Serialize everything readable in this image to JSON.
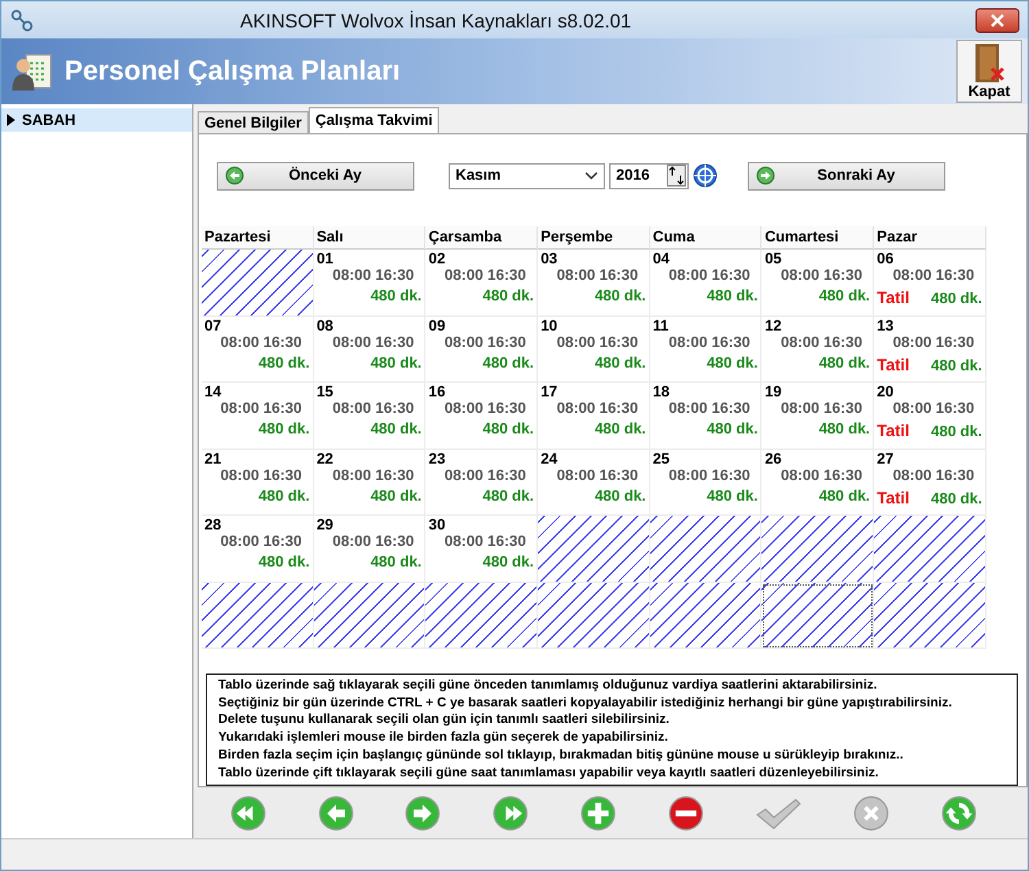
{
  "window": {
    "title": "AKINSOFT Wolvox İnsan Kaynakları s8.02.01"
  },
  "header": {
    "title": "Personel Çalışma Planları",
    "close_label": "Kapat"
  },
  "sidebar": {
    "items": [
      {
        "label": "SABAH",
        "selected": true
      }
    ]
  },
  "tabs": [
    {
      "label": "Genel Bilgiler",
      "selected": false
    },
    {
      "label": "Çalışma Takvimi",
      "selected": true
    }
  ],
  "navigation": {
    "previous": "Önceki Ay",
    "month": "Kasım",
    "year": "2016",
    "next": "Sonraki Ay"
  },
  "calendar": {
    "weekdays": [
      "Pazartesi",
      "Salı",
      "Çarsamba",
      "Perşembe",
      "Cuma",
      "Cumartesi",
      "Pazar"
    ],
    "weeks": [
      [
        {
          "kind": "blank",
          "selected": false
        },
        {
          "kind": "day",
          "day": "01",
          "hours": "08:00 16:30",
          "minutes": "480 dk.",
          "selected": false
        },
        {
          "kind": "day",
          "day": "02",
          "hours": "08:00 16:30",
          "minutes": "480 dk.",
          "selected": false
        },
        {
          "kind": "day",
          "day": "03",
          "hours": "08:00 16:30",
          "minutes": "480 dk.",
          "selected": false
        },
        {
          "kind": "day",
          "day": "04",
          "hours": "08:00 16:30",
          "minutes": "480 dk.",
          "selected": false
        },
        {
          "kind": "day",
          "day": "05",
          "hours": "08:00 16:30",
          "minutes": "480 dk.",
          "selected": false
        },
        {
          "kind": "day",
          "day": "06",
          "hours": "08:00 16:30",
          "minutes": "480 dk.",
          "holiday": "Tatil",
          "selected": false
        }
      ],
      [
        {
          "kind": "day",
          "day": "07",
          "hours": "08:00 16:30",
          "minutes": "480 dk.",
          "selected": false
        },
        {
          "kind": "day",
          "day": "08",
          "hours": "08:00 16:30",
          "minutes": "480 dk.",
          "selected": false
        },
        {
          "kind": "day",
          "day": "09",
          "hours": "08:00 16:30",
          "minutes": "480 dk.",
          "selected": false
        },
        {
          "kind": "day",
          "day": "10",
          "hours": "08:00 16:30",
          "minutes": "480 dk.",
          "selected": false
        },
        {
          "kind": "day",
          "day": "11",
          "hours": "08:00 16:30",
          "minutes": "480 dk.",
          "selected": false
        },
        {
          "kind": "day",
          "day": "12",
          "hours": "08:00 16:30",
          "minutes": "480 dk.",
          "selected": false
        },
        {
          "kind": "day",
          "day": "13",
          "hours": "08:00 16:30",
          "minutes": "480 dk.",
          "holiday": "Tatil",
          "selected": false
        }
      ],
      [
        {
          "kind": "day",
          "day": "14",
          "hours": "08:00 16:30",
          "minutes": "480 dk.",
          "selected": false
        },
        {
          "kind": "day",
          "day": "15",
          "hours": "08:00 16:30",
          "minutes": "480 dk.",
          "selected": false
        },
        {
          "kind": "day",
          "day": "16",
          "hours": "08:00 16:30",
          "minutes": "480 dk.",
          "selected": false
        },
        {
          "kind": "day",
          "day": "17",
          "hours": "08:00 16:30",
          "minutes": "480 dk.",
          "selected": false
        },
        {
          "kind": "day",
          "day": "18",
          "hours": "08:00 16:30",
          "minutes": "480 dk.",
          "selected": false
        },
        {
          "kind": "day",
          "day": "19",
          "hours": "08:00 16:30",
          "minutes": "480 dk.",
          "selected": false
        },
        {
          "kind": "day",
          "day": "20",
          "hours": "08:00 16:30",
          "minutes": "480 dk.",
          "holiday": "Tatil",
          "selected": false
        }
      ],
      [
        {
          "kind": "day",
          "day": "21",
          "hours": "08:00 16:30",
          "minutes": "480 dk.",
          "selected": false
        },
        {
          "kind": "day",
          "day": "22",
          "hours": "08:00 16:30",
          "minutes": "480 dk.",
          "selected": false
        },
        {
          "kind": "day",
          "day": "23",
          "hours": "08:00 16:30",
          "minutes": "480 dk.",
          "selected": false
        },
        {
          "kind": "day",
          "day": "24",
          "hours": "08:00 16:30",
          "minutes": "480 dk.",
          "selected": false
        },
        {
          "kind": "day",
          "day": "25",
          "hours": "08:00 16:30",
          "minutes": "480 dk.",
          "selected": false
        },
        {
          "kind": "day",
          "day": "26",
          "hours": "08:00 16:30",
          "minutes": "480 dk.",
          "selected": false
        },
        {
          "kind": "day",
          "day": "27",
          "hours": "08:00 16:30",
          "minutes": "480 dk.",
          "holiday": "Tatil",
          "selected": false
        }
      ],
      [
        {
          "kind": "day",
          "day": "28",
          "hours": "08:00 16:30",
          "minutes": "480 dk.",
          "selected": false
        },
        {
          "kind": "day",
          "day": "29",
          "hours": "08:00 16:30",
          "minutes": "480 dk.",
          "selected": false
        },
        {
          "kind": "day",
          "day": "30",
          "hours": "08:00 16:30",
          "minutes": "480 dk.",
          "selected": false
        },
        {
          "kind": "blank",
          "selected": false
        },
        {
          "kind": "blank",
          "selected": false
        },
        {
          "kind": "blank",
          "selected": false
        },
        {
          "kind": "blank",
          "selected": false
        }
      ],
      [
        {
          "kind": "blank",
          "selected": false
        },
        {
          "kind": "blank",
          "selected": false
        },
        {
          "kind": "blank",
          "selected": false
        },
        {
          "kind": "blank",
          "selected": false
        },
        {
          "kind": "blank",
          "selected": false
        },
        {
          "kind": "blank",
          "selected": true
        },
        {
          "kind": "blank",
          "selected": false
        }
      ]
    ]
  },
  "hints": [
    "Tablo üzerinde sağ tıklayarak seçili güne önceden tanımlamış olduğunuz vardiya saatlerini aktarabilirsiniz.",
    "Seçtiğiniz bir gün üzerinde CTRL + C ye basarak saatleri kopyalayabilir istediğiniz herhangi bir güne yapıştırabilirsiniz.",
    "Delete tuşunu kullanarak seçili olan gün için tanımlı saatleri silebilirsiniz.",
    "Yukarıdaki işlemleri mouse ile birden fazla gün seçerek de yapabilirsiniz.",
    "Birden fazla seçim için başlangıç gününde sol tıklayıp, bırakmadan bitiş gününe mouse u sürükleyip bırakınız..",
    "Tablo üzerinde çift tıklayarak seçili güne saat tanımlaması yapabilir veya kayıtlı saatleri düzenleyebilirsiniz."
  ],
  "toolbar": [
    {
      "kind": "first",
      "disabled": false
    },
    {
      "kind": "previous",
      "disabled": false
    },
    {
      "kind": "next",
      "disabled": false
    },
    {
      "kind": "last",
      "disabled": false
    },
    {
      "kind": "add",
      "disabled": false
    },
    {
      "kind": "delete",
      "disabled": false
    },
    {
      "kind": "confirm",
      "disabled": true
    },
    {
      "kind": "cancel",
      "disabled": true
    },
    {
      "kind": "refresh",
      "disabled": false
    }
  ]
}
